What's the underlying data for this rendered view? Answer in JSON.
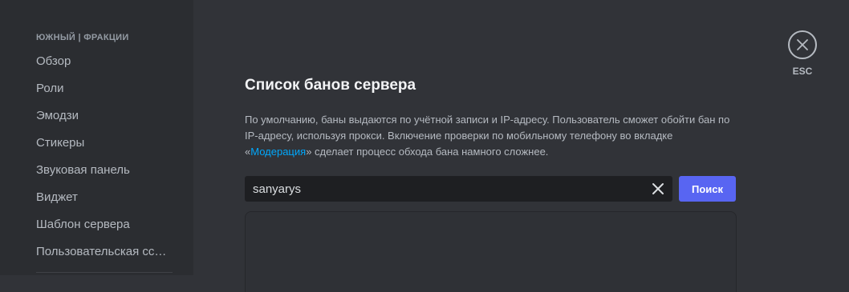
{
  "sidebar": {
    "header": "ЮЖНЫЙ | ФРАКЦИИ",
    "items": [
      {
        "label": "Обзор"
      },
      {
        "label": "Роли"
      },
      {
        "label": "Эмодзи"
      },
      {
        "label": "Стикеры"
      },
      {
        "label": "Звуковая панель"
      },
      {
        "label": "Виджет"
      },
      {
        "label": "Шаблон сервера"
      },
      {
        "label": "Пользовательская ссылка"
      }
    ]
  },
  "main": {
    "title": "Список банов сервера",
    "description": {
      "text_before": "По умолчанию, баны выдаются по учётной записи и IP-адресу. Пользователь сможет обойти бан по IP-адресу, используя прокси. Включение проверки по мобильному телефону во вкладке «",
      "link": "Модерация",
      "text_after": "» сделает процесс обхода бана намного сложнее."
    },
    "search": {
      "value": "sanyarys",
      "clear_icon": "close-icon"
    },
    "search_button": "Поиск"
  },
  "close": {
    "icon": "close-icon",
    "label": "ESC"
  },
  "colors": {
    "accent": "#5865f2",
    "link": "#00a8fc",
    "background": "#313338",
    "sidebar": "#2b2d31"
  }
}
